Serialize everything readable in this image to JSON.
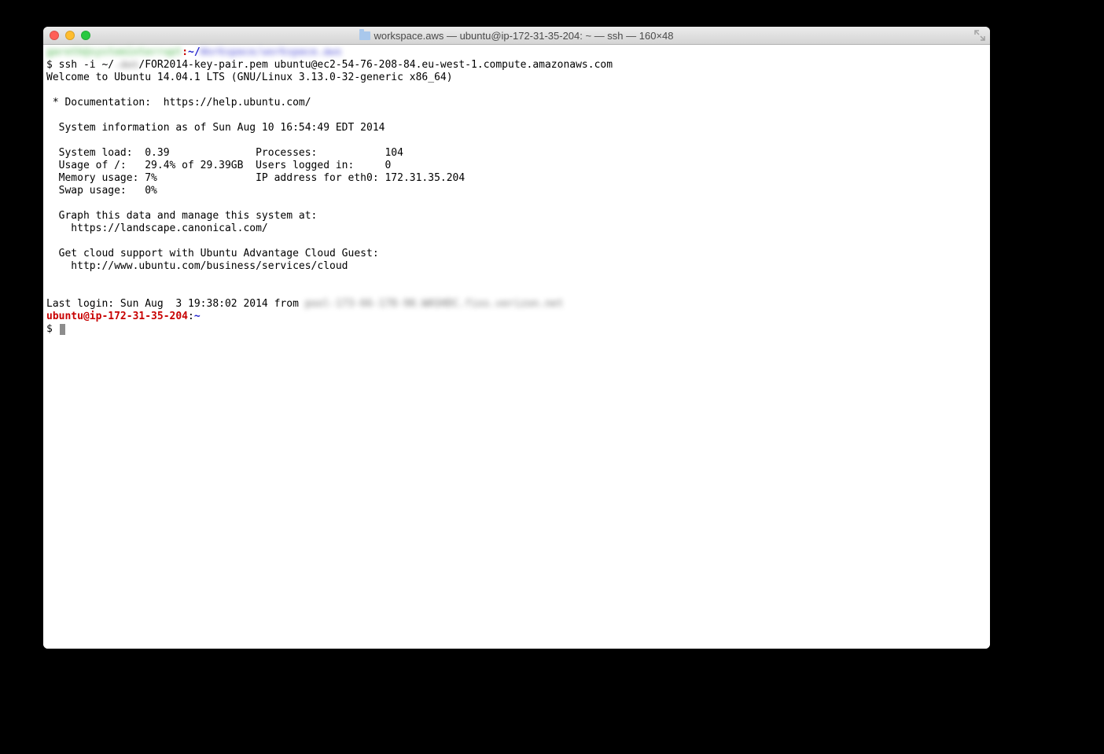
{
  "window": {
    "title": "workspace.aws — ubuntu@ip-172-31-35-204: ~ — ssh — 160×48"
  },
  "term": {
    "local_user_blur": "gareth@systeminterrupt",
    "local_sep": ":",
    "local_path_tilde": "~/",
    "local_path_blur": "Workspace/workspace.aws",
    "prompt1": "$ ssh -i ~/",
    "prompt1_blur": ".aws",
    "prompt1_rest": "/FOR2014-key-pair.pem ubuntu@ec2-54-76-208-84.eu-west-1.compute.amazonaws.com",
    "welcome": "Welcome to Ubuntu 14.04.1 LTS (GNU/Linux 3.13.0-32-generic x86_64)",
    "blank": "",
    "doc": " * Documentation:  https://help.ubuntu.com/",
    "sysinfo_hdr": "  System information as of Sun Aug 10 16:54:49 EDT 2014",
    "row1": "  System load:  0.39              Processes:           104",
    "row2": "  Usage of /:   29.4% of 29.39GB  Users logged in:     0",
    "row3": "  Memory usage: 7%                IP address for eth0: 172.31.35.204",
    "row4": "  Swap usage:   0%",
    "graph1": "  Graph this data and manage this system at:",
    "graph2": "    https://landscape.canonical.com/",
    "cloud1": "  Get cloud support with Ubuntu Advantage Cloud Guest:",
    "cloud2": "    http://www.ubuntu.com/business/services/cloud",
    "lastlogin_a": "Last login: Sun Aug  3 19:38:02 2014 from ",
    "lastlogin_blur": "pool-173-66-178-90.WASHDC.fios.verizon.net",
    "ps1_user": "ubuntu@ip-172-31-35-204",
    "ps1_sep": ":",
    "ps1_path": "~",
    "prompt2": "$ "
  }
}
